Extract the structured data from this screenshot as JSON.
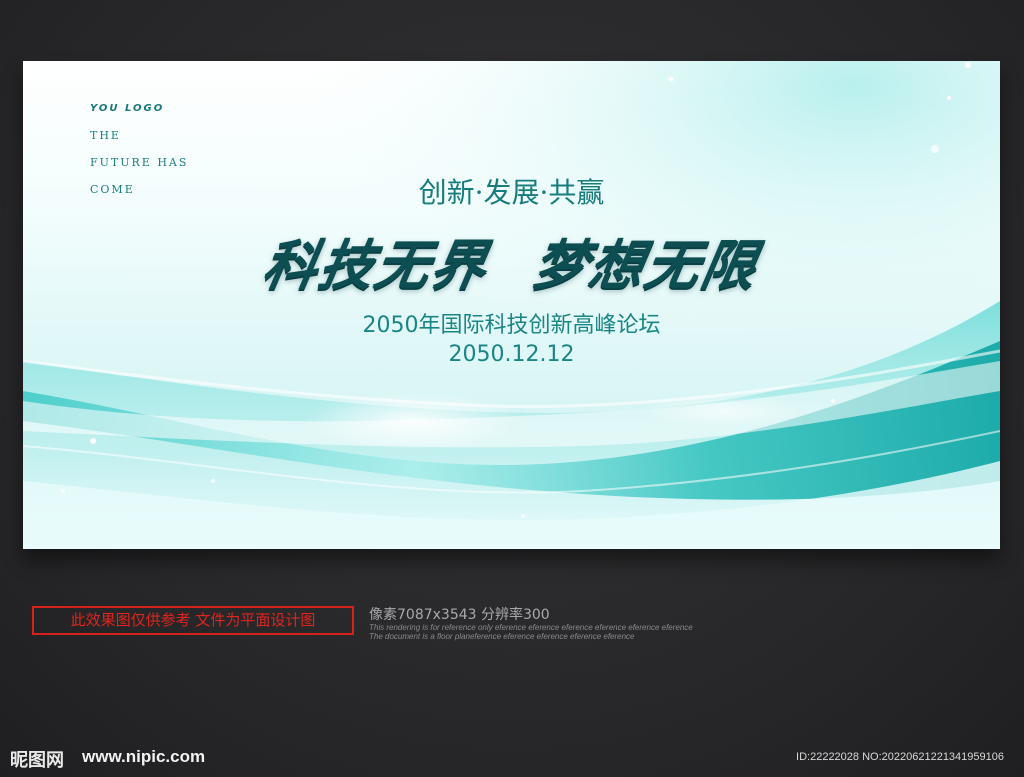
{
  "banner": {
    "logo_text": "YOU LOGO",
    "tagline_lines": [
      "THE",
      "FUTURE HAS",
      "COME"
    ],
    "slogan": "创新·发展·共赢",
    "main_title_part1": "科技无界",
    "main_title_part2": "梦想无限",
    "forum_title": "2050年国际科技创新高峰论坛",
    "event_date": "2050.12.12",
    "colors": {
      "accent_teal": "#1a8585",
      "title_dark": "#0c4e52",
      "wave_cyan": "#4fd6d2"
    }
  },
  "footer": {
    "notice": "此效果图仅供参考 文件为平面设计图",
    "spec": "像素7087x3543  分辨率300",
    "disclaimer_1": "This rendering is for reference only  eference eference eference eference eference eference",
    "disclaimer_2": "The document is a floor planeference eference eference eference eference",
    "notice_color": "#e0241e"
  },
  "watermark": {
    "site_logo": "昵图网",
    "site_url": "www.nipic.com",
    "image_id": "ID:22222028 NO:20220621221341959106"
  }
}
